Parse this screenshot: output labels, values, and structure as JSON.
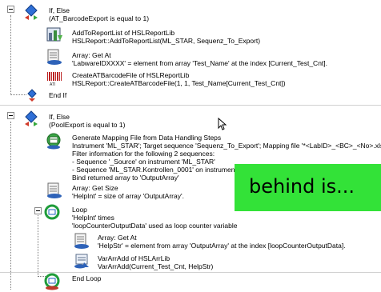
{
  "steps": [
    {
      "title": "If, Else",
      "detail": "(AT_BarcodeExport is equal to 1)"
    },
    {
      "title": "AddToReportList of HSLReportLib",
      "detail": "HSLReport::AddToReportList(ML_STAR, Sequenz_To_Export)"
    },
    {
      "title": "Array: Get At",
      "detail": "'LabwareIDXXXX' = element from array 'Test_Name' at the index [Current_Test_Cnt]."
    },
    {
      "title": "CreateATBarcodeFile of HSLReportLib",
      "detail": "HSLReport::CreateATBarcodeFile(1, 1, Test_Name[Current_Test_Cnt])"
    },
    {
      "title": "End If"
    },
    {
      "title": "If, Else",
      "detail": "(PoolExport is equal to 1)"
    },
    {
      "title": "Generate Mapping File from Data Handling Steps",
      "lines": [
        "Instrument 'ML_STAR';  Target sequence 'Sequenz_To_Export';  Mapping file '*<LabID>_<BC>_<No>.xls'';",
        "Filter information for the following 2 sequences:",
        "- Sequence '_Source' on instrument 'ML_STAR'",
        "- Sequence 'ML_STAR.Kontrollen_0001' on instrument 'M",
        "Bind returned array to 'OutputArray'"
      ]
    },
    {
      "title": "Array: Get Size",
      "detail": "'HelpInt' = size of array 'OutputArray'."
    },
    {
      "title": "Loop",
      "lines": [
        "'HelpInt' times",
        "'loopCounterOutputData' used as loop counter variable"
      ]
    },
    {
      "title": "Array: Get At",
      "detail": "'HelpStr' = element from array 'OutputArray' at the index [loopCounterOutputData]."
    },
    {
      "title": "VarArrAdd of HSLArrLib",
      "detail": "VarArrAdd(Current_Test_Cnt, HelpStr)"
    },
    {
      "title": "End Loop"
    }
  ],
  "overlay_text": "behind is...",
  "icons": [
    "if-else-icon",
    "add-to-report-icon",
    "array-get-icon",
    "barcode-icon",
    "end-if-icon",
    "mapping-file-icon",
    "array-size-icon",
    "loop-icon",
    "vararradd-icon",
    "end-loop-icon"
  ],
  "colors": {
    "overlay": "#33e238",
    "accent_blue": "#1f5fbf",
    "accent_red": "#c0392b"
  }
}
